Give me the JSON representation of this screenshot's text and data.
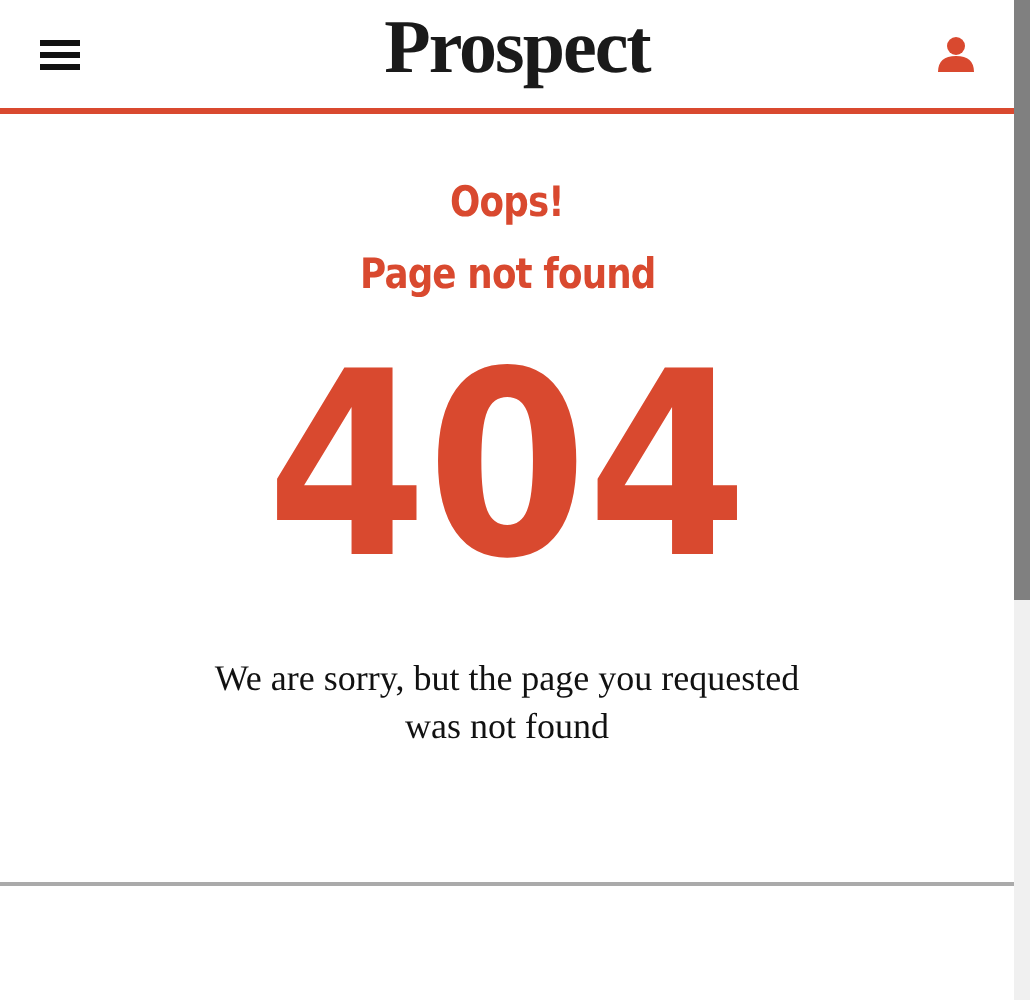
{
  "header": {
    "logo": "Prospect"
  },
  "error": {
    "title": "Oops!",
    "subtitle": "Page not found",
    "code": "404",
    "message": "We are sorry, but the page you requested was not found"
  }
}
